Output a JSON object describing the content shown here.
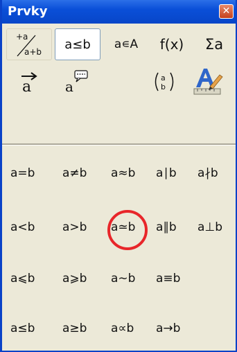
{
  "window": {
    "title": "Prvky",
    "close_glyph": "✕"
  },
  "toolbar": {
    "row1": [
      {
        "label": "+a/a+b",
        "icon": "unary-binary-operators-icon",
        "selected": false
      },
      {
        "label": "a≤b",
        "icon": "relations-icon",
        "selected": true
      },
      {
        "label": "a∊A",
        "icon": "set-operations-icon",
        "selected": false
      },
      {
        "label": "f(x)",
        "icon": "functions-icon",
        "selected": false
      },
      {
        "label": "Σa",
        "icon": "operators-icon",
        "selected": false
      }
    ],
    "row2": [
      {
        "label": "a⃗",
        "icon": "attributes-icon"
      },
      {
        "label": "a💬",
        "icon": "others-icon"
      },
      {
        "label": "(a/b)",
        "icon": "brackets-icon"
      },
      {
        "label": "A✎",
        "icon": "formats-icon"
      }
    ]
  },
  "relations": [
    [
      "a=b",
      "a≠b",
      "a≈b",
      "a∣b",
      "a∤b"
    ],
    [
      "a<b",
      "a>b",
      "a≃b",
      "a∥b",
      "a⊥b"
    ],
    [
      "a⩽b",
      "a⩾b",
      "a∼b",
      "a≡b"
    ],
    [
      "a≤b",
      "a≥b",
      "a∝b",
      "a→b"
    ]
  ],
  "highlight": {
    "color": "#e8262a",
    "target": "a≃b"
  }
}
